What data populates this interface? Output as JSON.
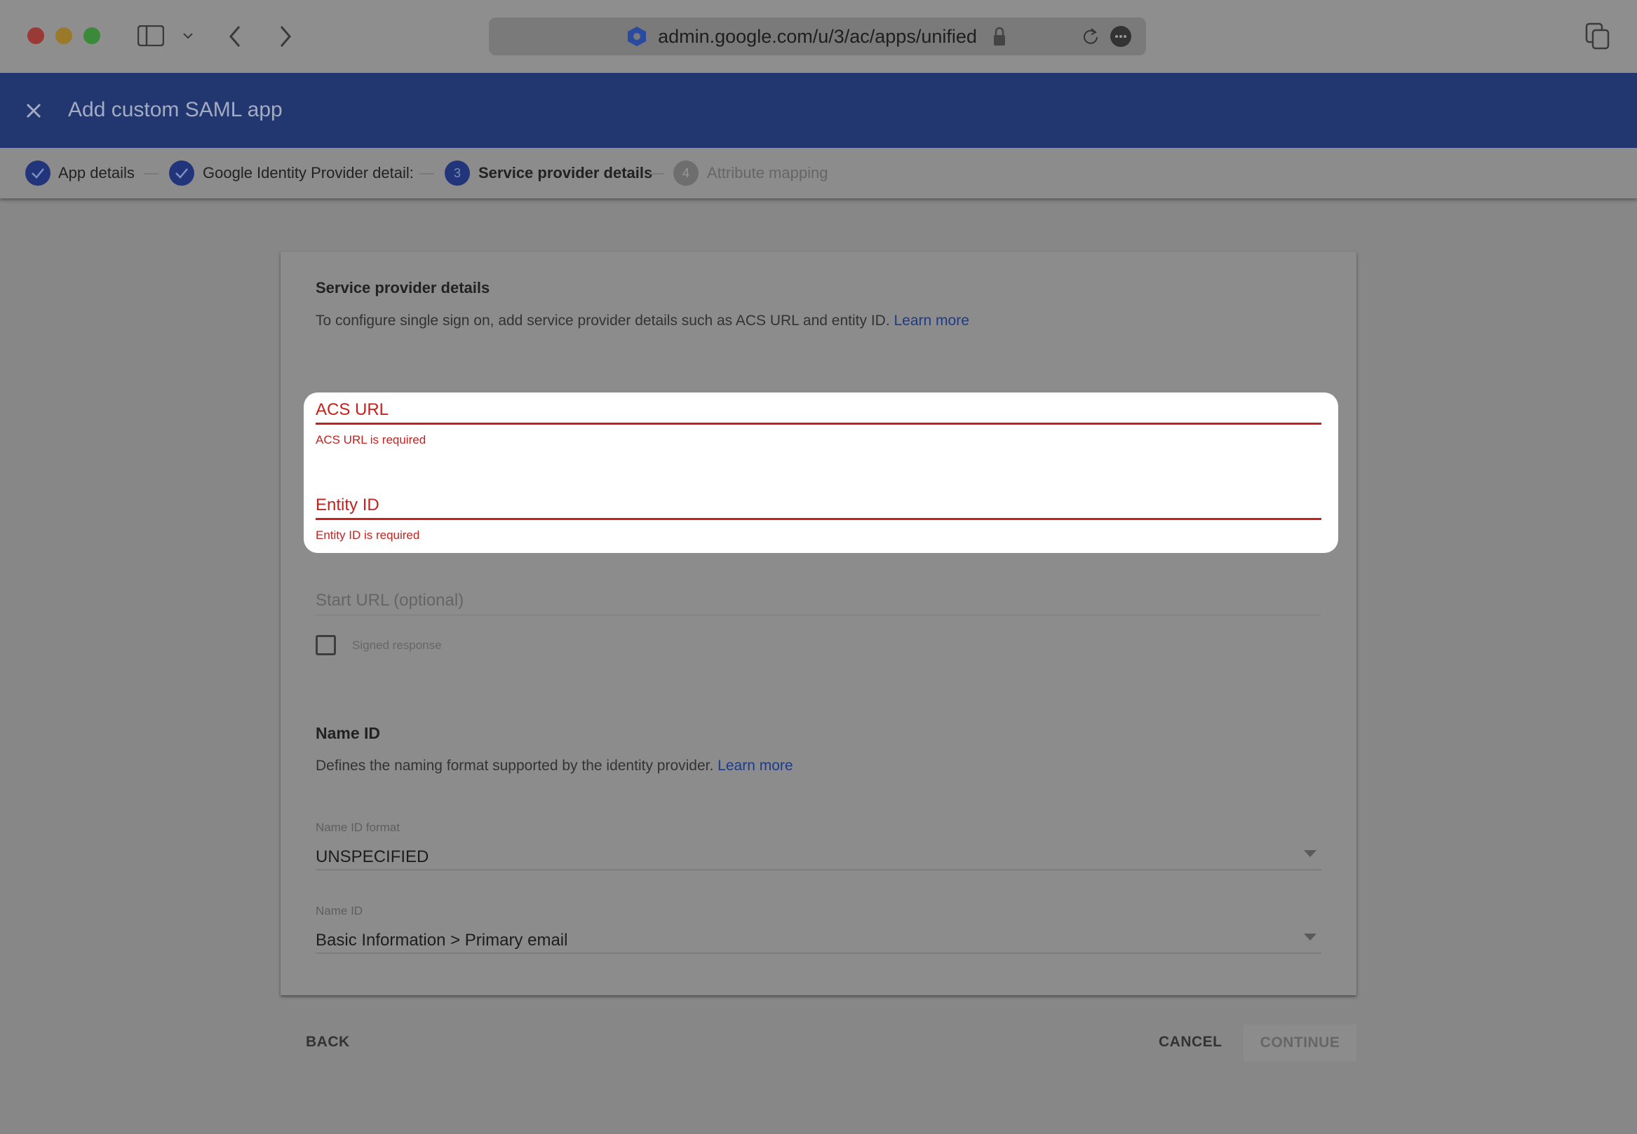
{
  "browser": {
    "url": "admin.google.com/u/3/ac/apps/unified"
  },
  "header": {
    "title": "Add custom SAML app"
  },
  "stepper": {
    "steps": [
      {
        "label": "App details",
        "state": "complete"
      },
      {
        "label": "Google Identity Provider detail:",
        "state": "complete"
      },
      {
        "label": "Service provider details",
        "state": "active",
        "number": "3"
      },
      {
        "label": "Attribute mapping",
        "state": "pending",
        "number": "4"
      }
    ]
  },
  "section": {
    "title": "Service provider details",
    "description": "To configure single sign on, add service provider details such as ACS URL and entity ID.",
    "learn_more": "Learn more"
  },
  "fields": {
    "acs_url": {
      "label": "ACS URL",
      "error": "ACS URL is required"
    },
    "entity_id": {
      "label": "Entity ID",
      "error": "Entity ID is required"
    },
    "start_url": {
      "placeholder": "Start URL (optional)"
    },
    "signed_response": {
      "label": "Signed response",
      "checked": false
    }
  },
  "name_id": {
    "title": "Name ID",
    "description": "Defines the naming format supported by the identity provider.",
    "learn_more": "Learn more",
    "format_label": "Name ID format",
    "format_value": "UNSPECIFIED",
    "nameid_label": "Name ID",
    "nameid_value": "Basic Information > Primary email"
  },
  "footer": {
    "back": "BACK",
    "cancel": "CANCEL",
    "continue": "CONTINUE"
  },
  "colors": {
    "header": "#22366f",
    "error": "#c5221f",
    "link": "#1e3a8a"
  }
}
